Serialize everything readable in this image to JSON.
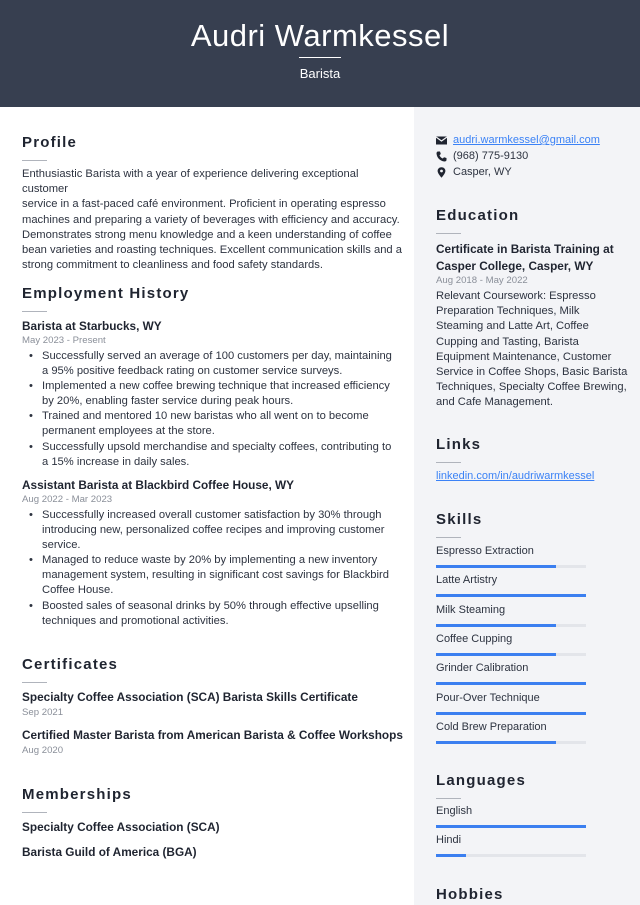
{
  "header": {
    "name": "Audri Warmkessel",
    "title": "Barista"
  },
  "profile": {
    "heading": "Profile",
    "lines": [
      "Enthusiastic Barista with a year of experience delivering exceptional customer",
      "service in a fast-paced café environment. Proficient in operating espresso",
      "machines and preparing a variety of beverages with efficiency and accuracy.",
      "Demonstrates strong menu knowledge and a keen understanding of coffee",
      "bean varieties and roasting techniques. Excellent communication skills and a",
      "strong commitment to cleanliness and food safety standards."
    ]
  },
  "employment": {
    "heading": "Employment History",
    "jobs": [
      {
        "title": "Barista at Starbucks, WY",
        "dates": "May 2023 - Present",
        "bullets": [
          "Successfully served an average of 100 customers per day, maintaining a 95% positive feedback rating on customer service surveys.",
          "Implemented a new coffee brewing technique that increased efficiency by 20%, enabling faster service during peak hours.",
          "Trained and mentored 10 new baristas who all went on to become permanent employees at the store.",
          "Successfully upsold merchandise and specialty coffees, contributing to a 15% increase in daily sales."
        ]
      },
      {
        "title": "Assistant Barista at Blackbird Coffee House, WY",
        "dates": "Aug 2022 - Mar 2023",
        "bullets": [
          "Successfully increased overall customer satisfaction by 30% through introducing new, personalized coffee recipes and improving customer service.",
          "Managed to reduce waste by 20% by implementing a new inventory management system, resulting in significant cost savings for Blackbird Coffee House.",
          "Boosted sales of seasonal drinks by 50% through effective upselling techniques and promotional activities."
        ]
      }
    ]
  },
  "certificates": {
    "heading": "Certificates",
    "items": [
      {
        "name": "Specialty Coffee Association (SCA) Barista Skills Certificate",
        "date": "Sep 2021"
      },
      {
        "name": "Certified Master Barista from American Barista & Coffee Workshops",
        "date": "Aug 2020"
      }
    ]
  },
  "memberships": {
    "heading": "Memberships",
    "items": [
      "Specialty Coffee Association (SCA)",
      "Barista Guild of America (BGA)"
    ]
  },
  "contact": {
    "email": "audri.warmkessel@gmail.com",
    "phone": "(968) 775-9130",
    "location": "Casper, WY",
    "icons": [
      "envelope-icon",
      "phone-icon",
      "map-pin-icon"
    ]
  },
  "education": {
    "heading": "Education",
    "degree_lines": [
      "Certificate in Barista Training at",
      "Casper College, Casper, WY"
    ],
    "dates": "Aug 2018 - May 2022",
    "desc_lines": [
      "Relevant Coursework: Espresso",
      "Preparation Techniques, Milk",
      "Steaming and Latte Art, Coffee",
      "Cupping and Tasting, Barista",
      "Equipment Maintenance, Customer",
      "Service in Coffee Shops, Basic Barista",
      "Techniques, Specialty Coffee Brewing,",
      "and Cafe Management."
    ]
  },
  "links": {
    "heading": "Links",
    "items": [
      "linkedin.com/in/audriwarmkessel"
    ]
  },
  "skills": {
    "heading": "Skills",
    "items": [
      {
        "name": "Espresso Extraction",
        "level": 0.8
      },
      {
        "name": "Latte Artistry",
        "level": 1.0
      },
      {
        "name": "Milk Steaming",
        "level": 0.8
      },
      {
        "name": "Coffee Cupping",
        "level": 0.8
      },
      {
        "name": "Grinder Calibration",
        "level": 1.0
      },
      {
        "name": "Pour-Over Technique",
        "level": 1.0
      },
      {
        "name": "Cold Brew Preparation",
        "level": 0.8
      }
    ]
  },
  "languages": {
    "heading": "Languages",
    "items": [
      {
        "name": "English",
        "level": 1.0
      },
      {
        "name": "Hindi",
        "level": 0.2
      }
    ]
  },
  "hobbies": {
    "heading": "Hobbies"
  },
  "colors": {
    "header_bg": "#373f50",
    "sidebar_bg": "#f3f4f7",
    "accent": "#3b7ff0",
    "link": "#3b82f6"
  }
}
